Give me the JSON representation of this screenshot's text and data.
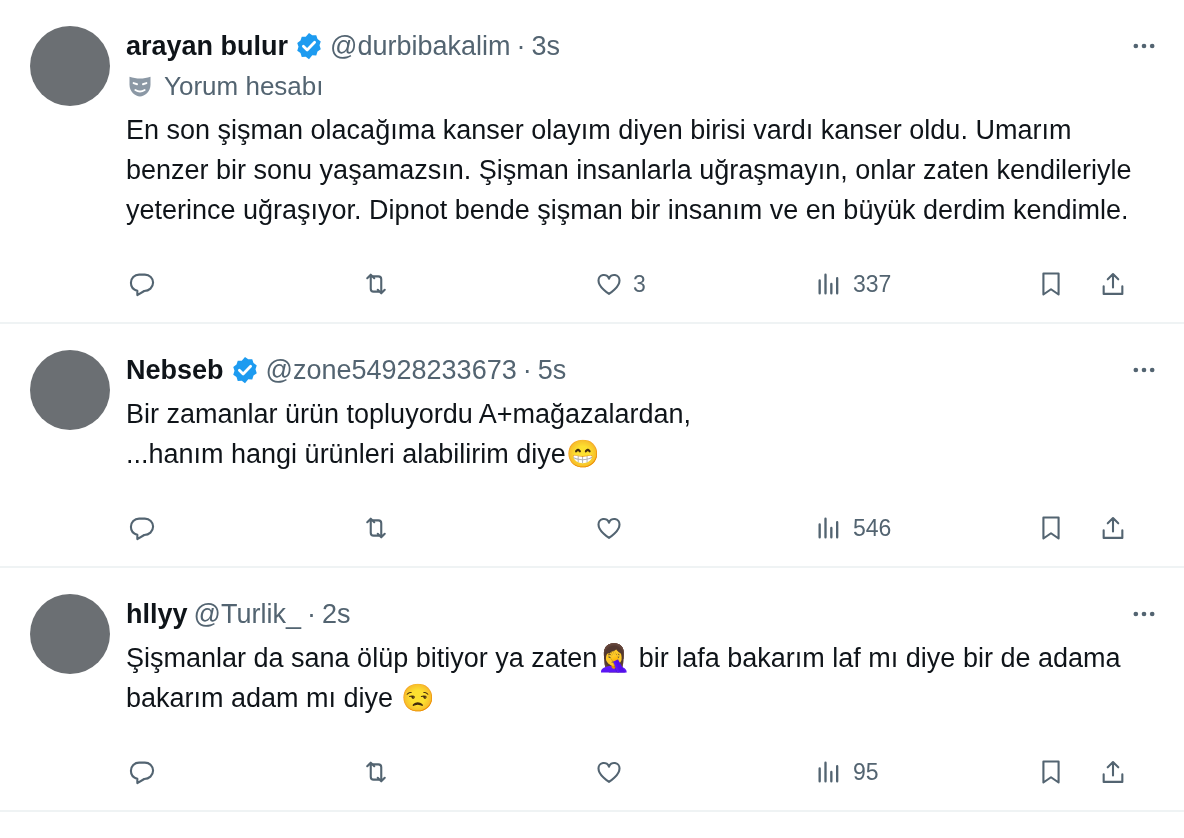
{
  "tweets": [
    {
      "name": "arayan bulur",
      "verified": true,
      "handle": "@durbibakalim",
      "separator": "·",
      "time": "3s",
      "account_label": "Yorum hesabı",
      "text": "En son şişman olacağıma kanser olayım diyen birisi vardı kanser oldu. Umarım benzer bir sonu yaşamazsın. Şişman insanlarla uğraşmayın, onlar zaten kendileriyle yeterince uğraşıyor. Dipnot bende şişman bir insanım ve en büyük derdim kendimle.",
      "likes": "3",
      "views": "337"
    },
    {
      "name": "Nebseb",
      "verified": true,
      "handle": "@zone54928233673",
      "separator": "·",
      "time": "5s",
      "text": "Bir zamanlar ürün topluyordu A+mağazalardan,\n...hanım hangi ürünleri alabilirim diye😁",
      "views": "546"
    },
    {
      "name": "hllyy",
      "verified": false,
      "handle": "@Turlik_",
      "separator": "·",
      "time": "2s",
      "text": "Şişmanlar da sana ölüp bitiyor ya zaten🤦‍♀️ bir lafa bakarım laf mı diye bir de adama bakarım adam mı diye 😒",
      "views": "95"
    }
  ]
}
